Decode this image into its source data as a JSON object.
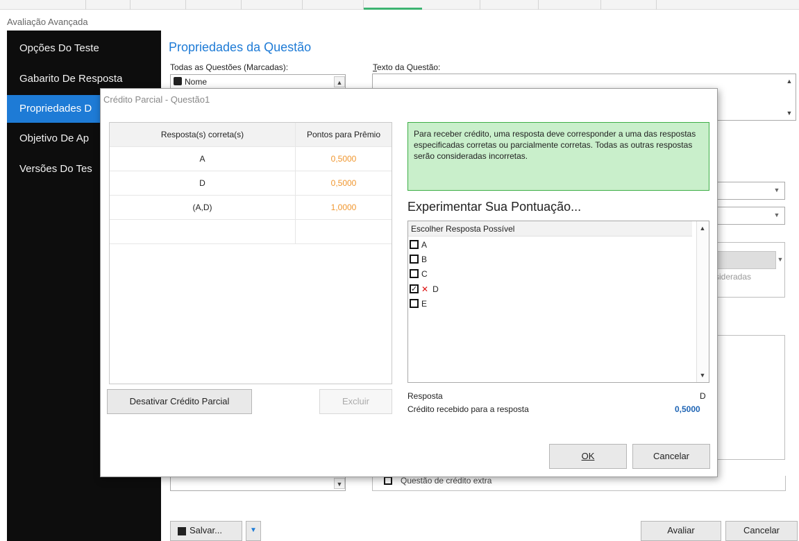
{
  "window": {
    "title": "Avaliação Avançada"
  },
  "sidebar": {
    "items": [
      {
        "label": "Opções Do Teste",
        "active": false
      },
      {
        "label": "Gabarito De Resposta",
        "active": false
      },
      {
        "label": "Propriedades D",
        "active": true
      },
      {
        "label": "Objetivo De Ap",
        "active": false
      },
      {
        "label": "Versões Do Tes",
        "active": false
      }
    ]
  },
  "main": {
    "heading": "Propriedades da Questão",
    "all_questions_label": "Todas as Questões (Marcadas):",
    "first_question_item": "Nome",
    "question_text_label": "Texto da Questão:",
    "question_text_label_accel": "T",
    "question_text_label_rest": "exto da Questão:",
    "partial_hidden_text": "sideradas",
    "bottom_hidden_text": "Questão de crédito extra"
  },
  "footer": {
    "save_label": "Salvar...",
    "save_label_accel": "l",
    "evaluate_label": "Avaliar",
    "cancel_label": "Cancelar"
  },
  "dialog": {
    "title": "Crédito Parcial - Questão1",
    "grid": {
      "headers": [
        "Resposta(s) correta(s)",
        "Pontos para Prêmio"
      ],
      "rows": [
        {
          "answer": "A",
          "points": "0,5000"
        },
        {
          "answer": "D",
          "points": "0,5000"
        },
        {
          "answer": "(A,D)",
          "points": "1,0000"
        },
        {
          "answer": "",
          "points": ""
        }
      ]
    },
    "info_text": "Para receber crédito, uma resposta deve corresponder a uma das respostas especificadas corretas ou parcialmente corretas. Todas as outras respostas serão consideradas incorretas.",
    "try_heading": "Experimentar Sua Pontuação...",
    "list_header": "Escolher Resposta Possível",
    "options": [
      {
        "label": "A",
        "checked": false,
        "marked_wrong": false
      },
      {
        "label": "B",
        "checked": false,
        "marked_wrong": false
      },
      {
        "label": "C",
        "checked": false,
        "marked_wrong": false
      },
      {
        "label": "D",
        "checked": true,
        "marked_wrong": true
      },
      {
        "label": "E",
        "checked": false,
        "marked_wrong": false
      }
    ],
    "answer_label": "Resposta",
    "answer_value": "D",
    "credit_label": "Crédito recebido para a resposta",
    "credit_value": "0,5000",
    "disable_button": "Desativar Crédito Parcial",
    "delete_button": "Excluir",
    "ok_button": "OK",
    "cancel_button": "Cancelar"
  },
  "colors": {
    "accent": "#1e7bd6",
    "sidebar_bg": "#0d0d0d",
    "points": "#f0962e",
    "info_bg": "#c9efcb",
    "info_border": "#3cae45",
    "credit_value": "#1e64b4"
  }
}
